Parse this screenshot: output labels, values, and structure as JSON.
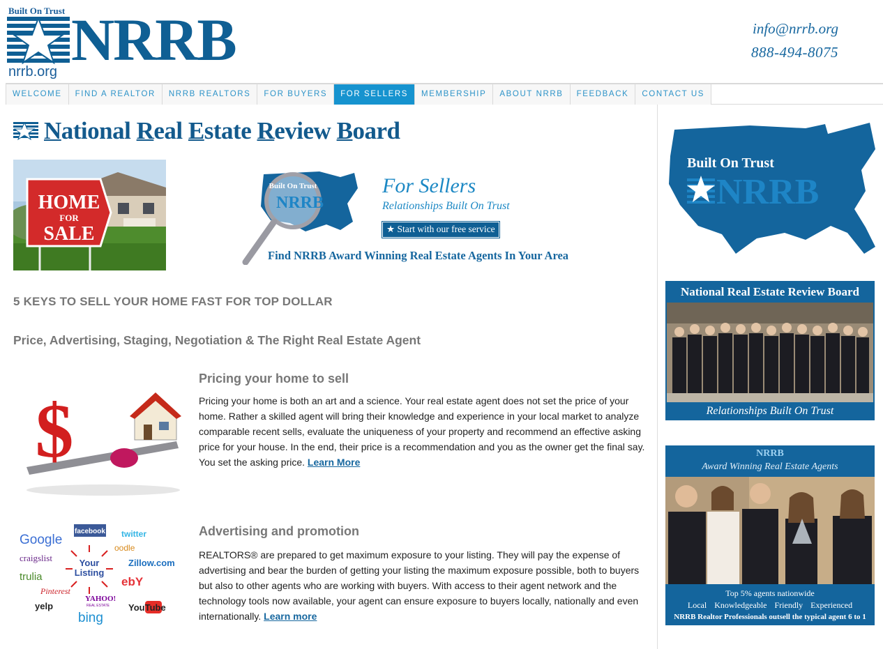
{
  "logo": {
    "tagline": "Built On Trust",
    "name": "NRRB",
    "url": "nrrb.org"
  },
  "contact": {
    "email": "info@nrrb.org",
    "phone": "888-494-8075"
  },
  "nav": {
    "items": [
      {
        "label": "WELCOME"
      },
      {
        "label": "FIND A REALTOR"
      },
      {
        "label": "NRRB REALTORS"
      },
      {
        "label": "FOR BUYERS"
      },
      {
        "label": "FOR SELLERS",
        "active": true
      },
      {
        "label": "MEMBERSHIP"
      },
      {
        "label": "ABOUT NRRB"
      },
      {
        "label": "FEEDBACK"
      },
      {
        "label": "CONTACT US"
      }
    ]
  },
  "main": {
    "title_parts": [
      {
        "cap": "N",
        "rest": "ational "
      },
      {
        "cap": "R",
        "rest": "eal "
      },
      {
        "cap": "E",
        "rest": "state "
      },
      {
        "cap": "R",
        "rest": "eview "
      },
      {
        "cap": "B",
        "rest": "oard"
      }
    ],
    "home_sign": {
      "line1": "HOME",
      "line2": "FOR",
      "line3": "SALE"
    },
    "banner": {
      "map_label_1": "Built On Trust",
      "map_label_2": "NRRB",
      "heading": "For Sellers",
      "subheading": "Relationships Built On Trust",
      "button": "★ Start with our free service",
      "find_text": "Find NRRB Award Winning Real Estate Agents In Your Area"
    },
    "heading_keys": "5 KEYS TO SELL YOUR HOME FAST FOR TOP DOLLAR",
    "heading_price": "Price, Advertising, Staging, Negotiation & The Right Real Estate Agent",
    "section1": {
      "title": "Pricing your home to sell",
      "body": "Pricing your home is both an art and a science. Your real estate agent does not set the price of your home. Rather a skilled agent will bring their knowledge and experience in your local market to analyze comparable recent sells, evaluate the uniqueness of your property and recommend an effective asking price for your house. In the end, their price is a recommendation and you as the owner get the final say. You set the asking price. ",
      "link": "Learn More"
    },
    "section2": {
      "title": "Advertising and promotion",
      "body": "REALTORS®  are prepared to get maximum exposure to your listing. They will pay the expense of advertising and bear the burden of getting your listing the maximum exposure possible, both to buyers but also to other agents who are working with buyers. With access to their agent network and the technology tools now available, your agent can ensure exposure to buyers locally, nationally and even internationally. ",
      "link": "Learn more"
    },
    "logo_cloud": {
      "google": "Google",
      "facebook": "facebook",
      "twitter": "twitter",
      "oodle": "oodle",
      "craigslist": "craigslist",
      "your": "Your",
      "listing": "Listing",
      "zillow": "Zillow.com",
      "trulia": "trulia",
      "ebay": "ebY",
      "pinterest": "Pinterest",
      "yahoo": "YAHOO!",
      "yahoo_sub": "REAL ESTATE",
      "yelp": "yelp",
      "bing": "bing",
      "youtube": "YouTube"
    }
  },
  "sidebar": {
    "map": {
      "label1": "Built On Trust",
      "label2": "NRRB"
    },
    "box1": {
      "title": "National Real Estate Review Board",
      "caption": "Relationships Built On Trust"
    },
    "box2": {
      "logo": "NRRB",
      "subtitle": "Award Winning Real Estate Agents",
      "line1": "Top 5% agents nationwide",
      "line2": "Local  Knowledgeable  Friendly  Experienced",
      "line3": "NRRB Realtor Professionals outsell the typical agent 6 to 1"
    }
  },
  "colors": {
    "brand": "#0f5f94",
    "nav_active": "#1693cf",
    "nav_text": "#2d93c8",
    "heading_gray": "#777777"
  }
}
